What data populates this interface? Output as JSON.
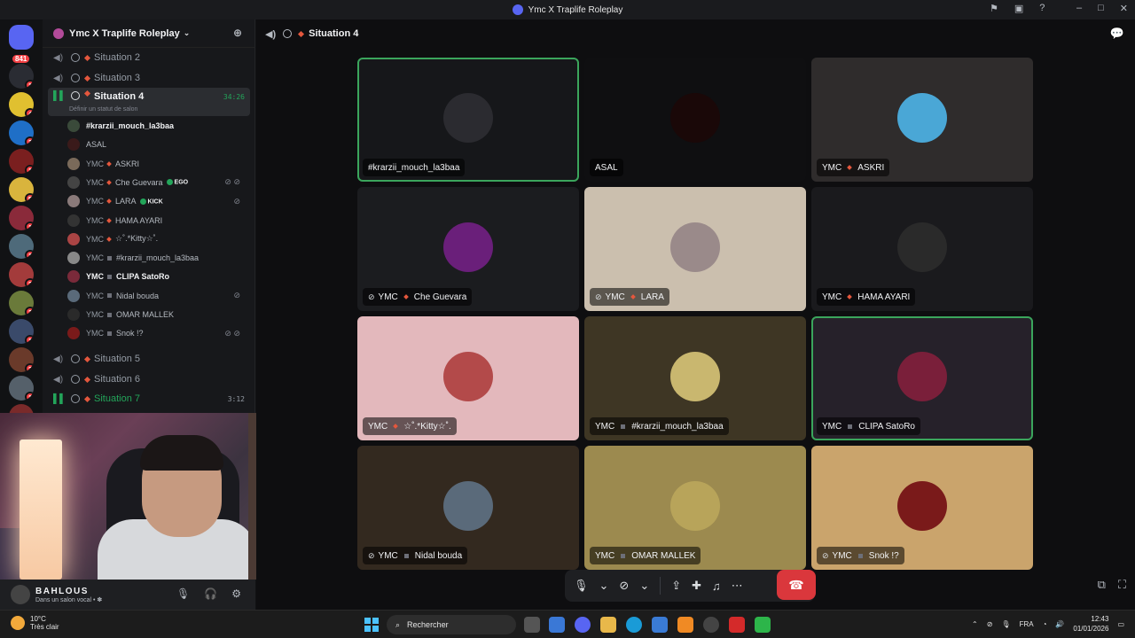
{
  "window": {
    "title": "Ymc X Traplife Roleplay"
  },
  "guilds": {
    "home_badge": "841",
    "items": [
      {
        "badge": "1",
        "color": "#2a2c33"
      },
      {
        "badge": "4",
        "color": "#e0c030"
      },
      {
        "badge": "3",
        "color": "#1f6fc7"
      },
      {
        "badge": "1",
        "color": "#7a1f1f"
      },
      {
        "badge": "5",
        "color": "#d9b43d"
      },
      {
        "badge": "1",
        "color": "#8a2a3a"
      },
      {
        "badge": "1",
        "color": "#4e6a7a"
      },
      {
        "badge": "2",
        "color": "#a33b3b"
      },
      {
        "badge": "2",
        "color": "#6a7a3a"
      },
      {
        "badge": "1",
        "color": "#3a4a6a"
      },
      {
        "badge": "2",
        "color": "#6a3a2a"
      },
      {
        "badge": "1",
        "color": "#55606a"
      },
      {
        "badge": "1",
        "color": "#7a2a2a"
      }
    ]
  },
  "server": {
    "name": "Ymc X Traplife Roleplay"
  },
  "channels": [
    {
      "name": "Situation 2"
    },
    {
      "name": "Situation 3"
    },
    {
      "name": "Situation 4",
      "time": "34:26",
      "status": "Définir un statut de salon"
    },
    {
      "name": "Situation 5"
    },
    {
      "name": "Situation 6"
    },
    {
      "name": "Situation 7",
      "time": "3:12"
    }
  ],
  "members": [
    {
      "tag": "",
      "name": "#krarzii_mouch_la3baa",
      "bright": true
    },
    {
      "tag": "",
      "name": "ASAL"
    },
    {
      "tag": "YMC",
      "name": "ASKRI"
    },
    {
      "tag": "YMC",
      "name": "Che Guevara",
      "pill": "EGO"
    },
    {
      "tag": "YMC",
      "name": "LARA",
      "pill": "KICK"
    },
    {
      "tag": "YMC",
      "name": "HAMA AYARI"
    },
    {
      "tag": "YMC",
      "name": "☆˚.*Kitty☆˚."
    },
    {
      "tag": "YMC",
      "name": "#krarzii_mouch_la3baa"
    },
    {
      "tag": "YMC",
      "name": "CLIPA SatoRo",
      "bright": true
    },
    {
      "tag": "YMC",
      "name": "Nidal bouda"
    },
    {
      "tag": "YMC",
      "name": "OMAR MALLEK"
    },
    {
      "tag": "YMC",
      "name": "Snok !?"
    }
  ],
  "user": {
    "name": "BAHLOUS",
    "status": "Dans un salon vocal • ✽"
  },
  "call": {
    "channel": "Situation 4"
  },
  "tiles": [
    {
      "tag": "",
      "name": "#krarzii_mouch_la3baa",
      "bg": "#16171a",
      "av": "#2b2b30"
    },
    {
      "tag": "",
      "name": "ASAL",
      "bg": "#0f0f11",
      "av": "#1a0808"
    },
    {
      "tag": "YMC",
      "name": "ASKRI",
      "bg": "#2f2c2c",
      "av": "#4aa7d6"
    },
    {
      "tag": "YMC",
      "name": "Che Guevara",
      "bg": "#1b1c1f",
      "av": "#6a1f7a"
    },
    {
      "tag": "YMC",
      "name": "LARA",
      "bg": "#cbbfae",
      "av": "#9a8a8a"
    },
    {
      "tag": "YMC",
      "name": "HAMA AYARI",
      "bg": "#1a1a1d",
      "av": "#2a2a2a"
    },
    {
      "tag": "YMC",
      "name": "☆˚.*Kitty☆˚.",
      "bg": "#e3b8bc",
      "av": "#b34a4a"
    },
    {
      "tag": "YMC",
      "name": "#krarzii_mouch_la3baa",
      "bg": "#3e3624",
      "av": "#c9b76f"
    },
    {
      "tag": "YMC",
      "name": "CLIPA SatoRo",
      "bg": "#26212a",
      "av": "#7a1f3a"
    },
    {
      "tag": "YMC",
      "name": "Nidal bouda",
      "bg": "#33291f",
      "av": "#5a6a7a"
    },
    {
      "tag": "YMC",
      "name": "OMAR MALLEK",
      "bg": "#9c8a4f",
      "av": "#b8a45a"
    },
    {
      "tag": "YMC",
      "name": "Snok !?",
      "bg": "#caa46c",
      "av": "#7a1a1a"
    }
  ],
  "taskbar": {
    "temp": "10°C",
    "weather": "Très clair",
    "search_placeholder": "Rechercher",
    "lang": "FRA",
    "time": "12:43",
    "date": "01/01/2026"
  }
}
